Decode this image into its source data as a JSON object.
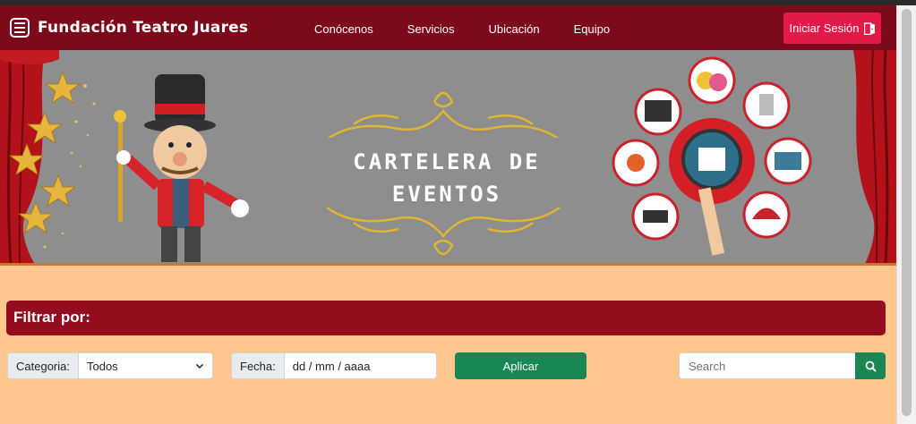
{
  "navbar": {
    "brand": "Fundación Teatro Juares",
    "links": [
      "Conócenos",
      "Servicios",
      "Ubicación",
      "Equipo"
    ],
    "login_label": "Iniciar Sesión",
    "login_icon": "door-open-icon",
    "menu_icon": "hamburger-menu-icon"
  },
  "banner": {
    "title_line1": "CARTELERA DE",
    "title_line2": "EVENTOS",
    "images": [
      "ringmaster-mascot",
      "theatre-curtains",
      "theatre-icons-infographic"
    ]
  },
  "filter": {
    "heading": "Filtrar por:",
    "category_label": "Categoria:",
    "category_value": "Todos",
    "date_label": "Fecha:",
    "date_placeholder": "dd / mm / aaaa",
    "apply_label": "Aplicar",
    "search_placeholder": "Search",
    "search_icon": "search-icon"
  },
  "colors": {
    "navbar": "#7d0a1a",
    "login": "#e21a4a",
    "page_bg": "#ffc78e",
    "filter_header": "#930d1e",
    "success": "#198754"
  }
}
